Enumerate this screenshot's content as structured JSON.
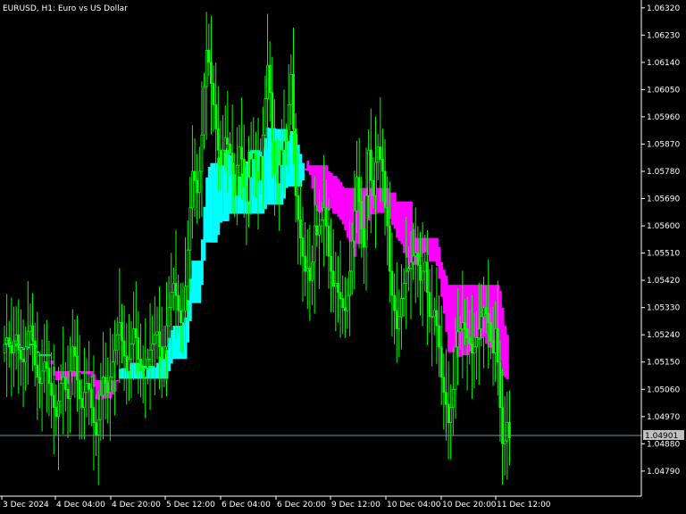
{
  "window": {
    "symbol_title": "EURUSD, H1:  Euro vs US Dollar"
  },
  "chart_data": {
    "type": "candlestick",
    "title": "EURUSD, H1:  Euro vs US Dollar",
    "symbol": "EURUSD",
    "timeframe": "H1",
    "current_price": "1.04901",
    "ylim": [
      1.0471,
      1.0634
    ],
    "y_ticks": [
      "1.06320",
      "1.06230",
      "1.06140",
      "1.06050",
      "1.05960",
      "1.05870",
      "1.05780",
      "1.05690",
      "1.05600",
      "1.05510",
      "1.05420",
      "1.05330",
      "1.05240",
      "1.05150",
      "1.05060",
      "1.04970",
      "1.04880",
      "1.04790"
    ],
    "x_ticks": [
      "3 Dec 2024",
      "4 Dec 04:00",
      "4 Dec 20:00",
      "5 Dec 12:00",
      "6 Dec 04:00",
      "6 Dec 20:00",
      "9 Dec 12:00",
      "10 Dec 04:00",
      "10 Dec 20:00",
      "11 Dec 12:00"
    ],
    "grid": false,
    "colors": {
      "background": "#000000",
      "candle": "#00ff00",
      "cloud_up": "#00ffff",
      "cloud_down": "#ff00ff",
      "current_price_line": "#8090a0",
      "price_label_bg": "#c0c0c0",
      "text": "#ffffff",
      "axis_line": "#ffffff"
    },
    "close": [
      1.0521,
      1.0523,
      1.052,
      1.0518,
      1.0522,
      1.0524,
      1.0519,
      1.0516,
      1.0515,
      1.052,
      1.0525,
      1.0527,
      1.0522,
      1.0514,
      1.051,
      1.0508,
      1.0512,
      1.0515,
      1.0513,
      1.0508,
      1.0504,
      1.05,
      1.0497,
      1.0502,
      1.0508,
      1.051,
      1.0506,
      1.0503,
      1.0512,
      1.052,
      1.0517,
      1.0509,
      1.0503,
      1.05,
      1.0505,
      1.0508,
      1.0506,
      1.05,
      1.0495,
      1.0491,
      1.0496,
      1.0504,
      1.051,
      1.0508,
      1.0505,
      1.051,
      1.0515,
      1.0519,
      1.0524,
      1.0528,
      1.0522,
      1.0517,
      1.0512,
      1.0516,
      1.0521,
      1.0526,
      1.0523,
      1.0516,
      1.0512,
      1.051,
      1.0513,
      1.0516,
      1.0519,
      1.0521,
      1.0524,
      1.0525,
      1.052,
      1.0516,
      1.052,
      1.0527,
      1.0533,
      1.0538,
      1.0541,
      1.0537,
      1.0532,
      1.0528,
      1.0532,
      1.054,
      1.0552,
      1.0566,
      1.0578,
      1.0575,
      1.0571,
      1.0578,
      1.059,
      1.0606,
      1.0618,
      1.0614,
      1.0607,
      1.06,
      1.0592,
      1.0585,
      1.058,
      1.0585,
      1.0589,
      1.0587,
      1.0584,
      1.0577,
      1.057,
      1.058,
      1.0586,
      1.0582,
      1.0573,
      1.0568,
      1.0576,
      1.0582,
      1.0584,
      1.0578,
      1.0575,
      1.0583,
      1.059,
      1.0602,
      1.0613,
      1.0604,
      1.0588,
      1.0577,
      1.0574,
      1.058,
      1.0585,
      1.0588,
      1.0588,
      1.06,
      1.061,
      1.0592,
      1.057,
      1.0562,
      1.0556,
      1.055,
      1.0545,
      1.0546,
      1.0542,
      1.0548,
      1.056,
      1.0557,
      1.056,
      1.0562,
      1.0566,
      1.056,
      1.055,
      1.0545,
      1.054,
      1.0541,
      1.0538,
      1.0536,
      1.0533,
      1.0532,
      1.0537,
      1.0545,
      1.0555,
      1.0565,
      1.0576,
      1.0568,
      1.0559,
      1.0553,
      1.057,
      1.0585,
      1.0575,
      1.057,
      1.0581,
      1.0586,
      1.0582,
      1.0578,
      1.0566,
      1.056,
      1.0545,
      1.0537,
      1.0532,
      1.0526,
      1.053,
      1.0536,
      1.0541,
      1.0545,
      1.0546,
      1.0548,
      1.055,
      1.0551,
      1.0547,
      1.0542,
      1.0545,
      1.0548,
      1.0538,
      1.053,
      1.053,
      1.0532,
      1.0527,
      1.052,
      1.051,
      1.0505,
      1.0501,
      1.0495,
      1.05,
      1.0506,
      1.052,
      1.0525,
      1.0526,
      1.0528,
      1.0526,
      1.0523,
      1.0521,
      1.0518,
      1.052,
      1.0523,
      1.0526,
      1.053,
      1.0533,
      1.0531,
      1.0528,
      1.0522,
      1.0518,
      1.0526,
      1.0515,
      1.05,
      1.0488,
      1.0489,
      1.0495,
      1.049
    ]
  }
}
